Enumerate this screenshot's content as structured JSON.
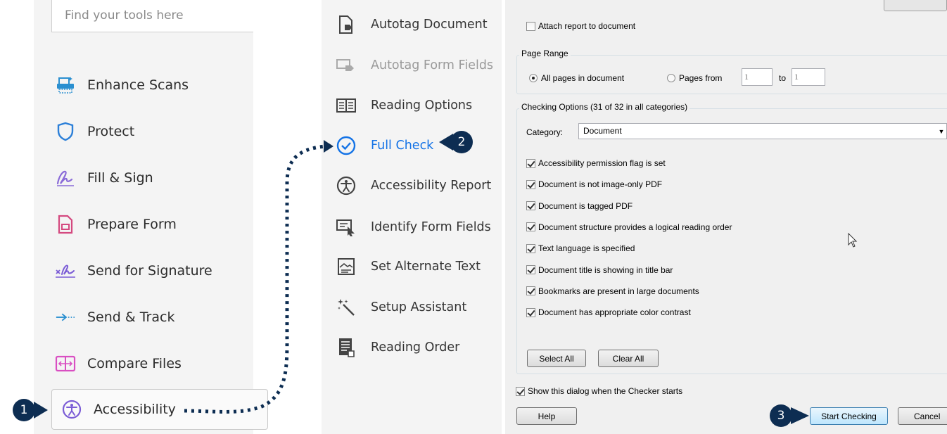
{
  "colors": {
    "accent": "#1473e6",
    "callout": "#0d2d52",
    "panel_bg": "#f4f4f4",
    "dialog_bg": "#f0f0f0"
  },
  "left_panel": {
    "search_placeholder": "Find your tools here",
    "tools": [
      {
        "label": "Enhance Scans",
        "icon": "scanner-icon"
      },
      {
        "label": "Protect",
        "icon": "shield-icon"
      },
      {
        "label": "Fill & Sign",
        "icon": "pen-signature-icon"
      },
      {
        "label": "Prepare Form",
        "icon": "form-document-icon"
      },
      {
        "label": "Send for Signature",
        "icon": "signature-x-icon"
      },
      {
        "label": "Send & Track",
        "icon": "arrow-right-icon"
      },
      {
        "label": "Compare Files",
        "icon": "compare-files-icon"
      },
      {
        "label": "Accessibility",
        "icon": "accessibility-icon"
      }
    ]
  },
  "middle_panel": {
    "tools": [
      {
        "label": "Autotag Document",
        "icon": "tag-document-icon",
        "state": "normal"
      },
      {
        "label": "Autotag Form Fields",
        "icon": "tag-form-icon",
        "state": "disabled"
      },
      {
        "label": "Reading Options",
        "icon": "book-icon",
        "state": "normal"
      },
      {
        "label": "Full Check",
        "icon": "check-circle-icon",
        "state": "active"
      },
      {
        "label": "Accessibility Report",
        "icon": "accessibility-icon",
        "state": "normal"
      },
      {
        "label": "Identify Form Fields",
        "icon": "form-cursor-icon",
        "state": "normal"
      },
      {
        "label": "Set Alternate Text",
        "icon": "image-text-icon",
        "state": "normal"
      },
      {
        "label": "Setup Assistant",
        "icon": "magic-wand-icon",
        "state": "normal"
      },
      {
        "label": "Reading Order",
        "icon": "reading-order-icon",
        "state": "normal"
      }
    ]
  },
  "dialog": {
    "attach_report_label": "Attach report to document",
    "attach_report_checked": false,
    "page_range": {
      "title": "Page Range",
      "all_pages_label": "All pages in document",
      "all_pages_selected": true,
      "pages_from_label": "Pages from",
      "from_value": "1",
      "to_label": "to",
      "to_value": "1"
    },
    "checking_options": {
      "title": "Checking Options (31 of 32 in all categories)",
      "category_label": "Category:",
      "category_value": "Document",
      "items": [
        {
          "label": "Accessibility permission flag is set",
          "checked": true
        },
        {
          "label": "Document is not image-only PDF",
          "checked": true
        },
        {
          "label": "Document is tagged PDF",
          "checked": true
        },
        {
          "label": "Document structure provides a logical reading order",
          "checked": true
        },
        {
          "label": "Text language is specified",
          "checked": true
        },
        {
          "label": "Document title is showing in title bar",
          "checked": true
        },
        {
          "label": "Bookmarks are present in large documents",
          "checked": true
        },
        {
          "label": "Document has appropriate color contrast",
          "checked": true
        }
      ],
      "select_all_label": "Select All",
      "clear_all_label": "Clear All"
    },
    "show_dialog_label": "Show this dialog when the Checker starts",
    "show_dialog_checked": true,
    "help_label": "Help",
    "start_checking_label": "Start Checking",
    "cancel_label": "Cancel"
  },
  "callouts": {
    "step1": "1",
    "step2": "2",
    "step3": "3"
  }
}
